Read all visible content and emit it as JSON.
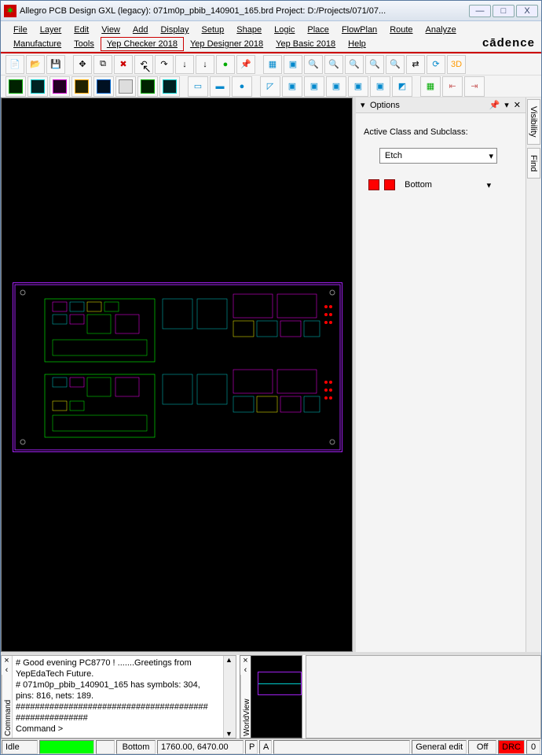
{
  "title": "Allegro PCB Design GXL (legacy): 071m0p_pbib_140901_165.brd  Project: D:/Projects/071/07...",
  "menu": {
    "row1": [
      "File",
      "Layer",
      "Edit",
      "View",
      "Add",
      "Display",
      "Setup",
      "Shape",
      "Logic",
      "Place",
      "FlowPlan",
      "Route",
      "Analyze"
    ],
    "row2": [
      "Manufacture",
      "Tools",
      "Yep Checker 2018",
      "Yep Designer 2018",
      "Yep Basic 2018",
      "Help"
    ],
    "highlighted": "Yep Checker 2018"
  },
  "logo": "cādence",
  "options": {
    "panel_title": "Options",
    "active_label": "Active Class and Subclass:",
    "class_value": "Etch",
    "sub_value": "Bottom",
    "sub_color": "#ff0000"
  },
  "side_tabs": [
    "Visibility",
    "Find"
  ],
  "console": {
    "label": "Command",
    "lines": [
      "#  Good evening PC8770 !      .......Greetings from YepEdaTech Future.",
      "#  071m0p_pbib_140901_165 has symbols: 304, pins: 816, nets: 189.",
      "########################################",
      "###############",
      "Command >"
    ]
  },
  "worldview_label": "WorldView",
  "status": {
    "mode": "Idle",
    "layer": "Bottom",
    "coords": "1760.00, 6470.00",
    "p": "P",
    "a": "A",
    "edit": "General edit",
    "off": "Off",
    "drc": "DRC",
    "zero": "0"
  },
  "winbtns": {
    "min": "—",
    "max": "□",
    "close": "X"
  },
  "toolbar1_icons": [
    "new-icon",
    "open-icon",
    "save-icon",
    "move-icon",
    "copy-icon",
    "delete-icon",
    "undo-icon",
    "redo-icon",
    "down1-icon",
    "down2-icon",
    "circle-icon",
    "pin-icon",
    "grid1-icon",
    "grid2-icon",
    "zoomfit-icon",
    "zoomin-icon",
    "zoomwin-icon",
    "zoomout-icon",
    "zoom-icon",
    "swap-icon",
    "redraw-icon",
    "3d-icon"
  ],
  "toolbar2_icons": [
    "lyr-green",
    "lyr-cyan",
    "lyr-magenta",
    "lyr-orange",
    "lyr-blue",
    "lyr-gray",
    "lyr-green2",
    "lyr-cyan2",
    "cline-a",
    "cline-b",
    "shape-a",
    "select",
    "rect-a",
    "rect-b",
    "rect-c",
    "rect-d",
    "rect-e",
    "poly",
    "shadow",
    "hsize",
    "halign"
  ]
}
